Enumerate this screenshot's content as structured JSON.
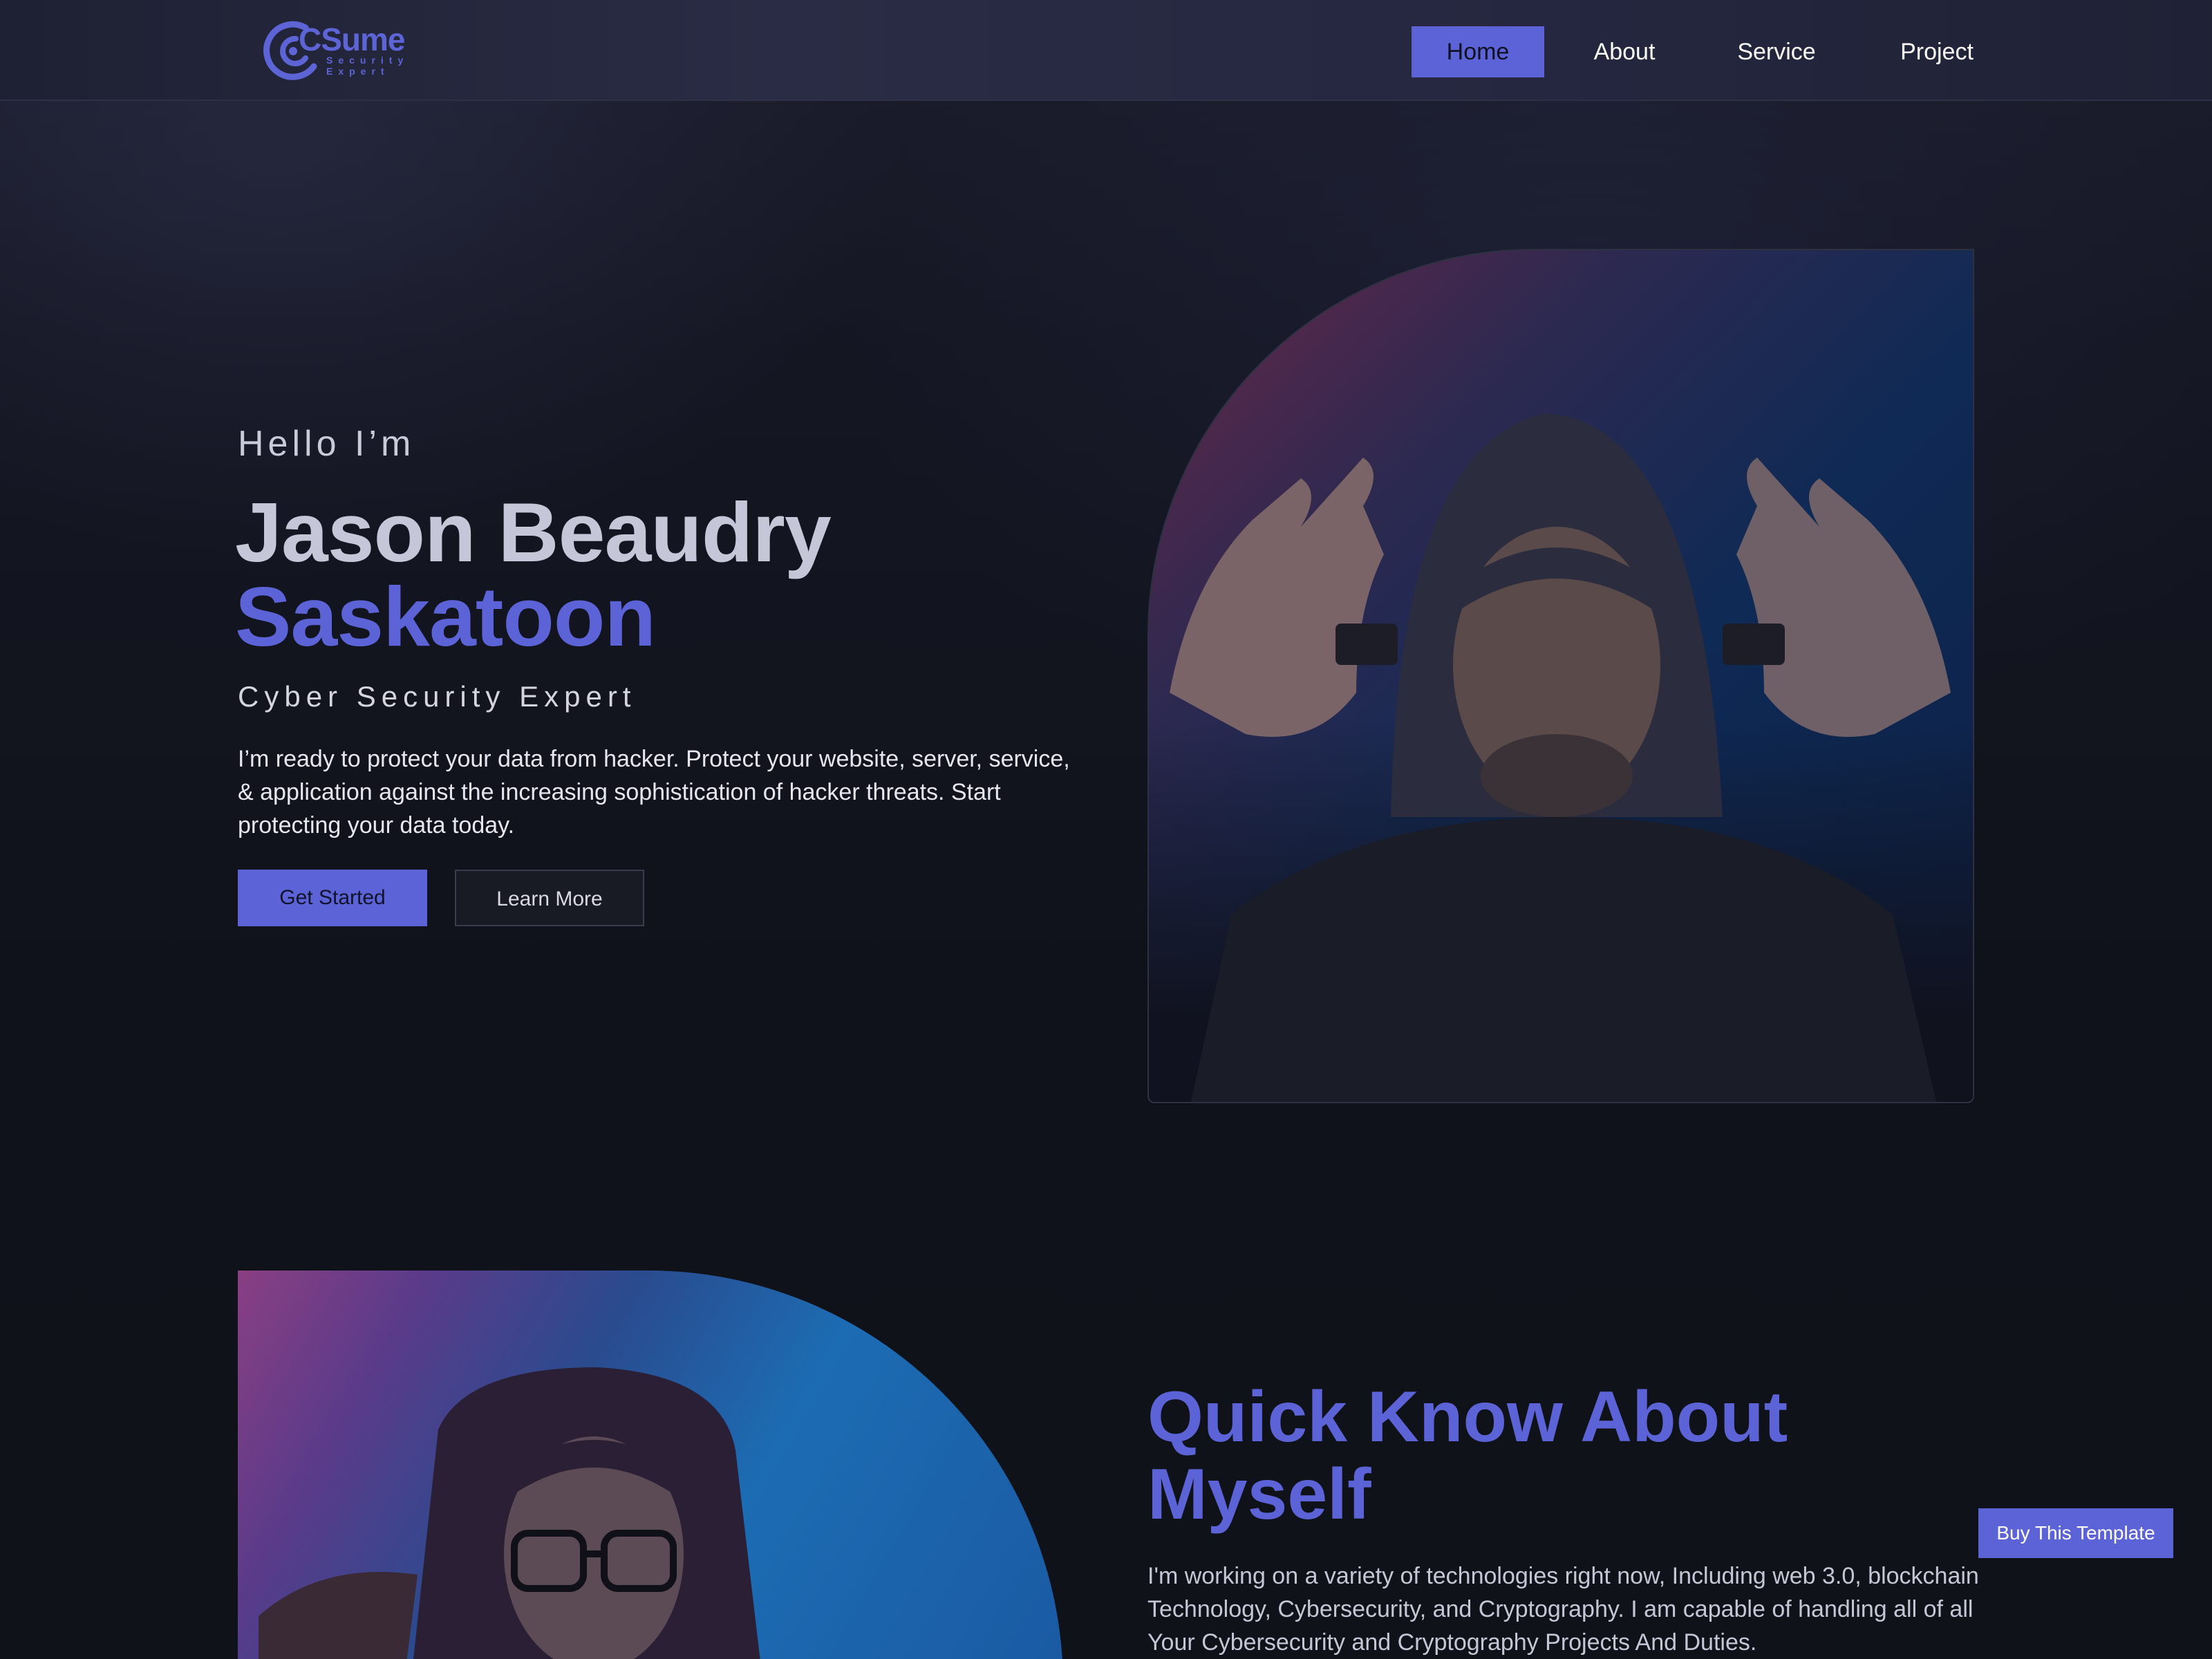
{
  "brand": {
    "name": "CSume",
    "tagline_line1": "Security",
    "tagline_line2": "Expert",
    "accent_color": "#5c63d6"
  },
  "nav": {
    "items": [
      {
        "label": "Home",
        "active": true
      },
      {
        "label": "About",
        "active": false
      },
      {
        "label": "Service",
        "active": false
      },
      {
        "label": "Project",
        "active": false
      }
    ]
  },
  "hero": {
    "greeting": "Hello I’m",
    "name_line1": "Jason Beaudry",
    "name_line2": "Saskatoon",
    "role": "Cyber Security Expert",
    "intro": "I’m ready to protect your data from hacker. Protect your website, server, service, & application against the increasing sophistication of hacker threats. Start protecting your data today.",
    "primary_button": "Get Started",
    "secondary_button": "Learn More",
    "photo_icon": "portrait-photo"
  },
  "about": {
    "title": "Quick Know About Myself",
    "text": "I'm working on a variety of technologies right now, Including web 3.0, blockchain Technology, Cybersecurity, and Cryptography. I am capable of handling all of all Your Cybersecurity and Cryptography Projects And Duties.",
    "photo_icon": "portrait-photo"
  },
  "buy_button": "Buy This Template"
}
